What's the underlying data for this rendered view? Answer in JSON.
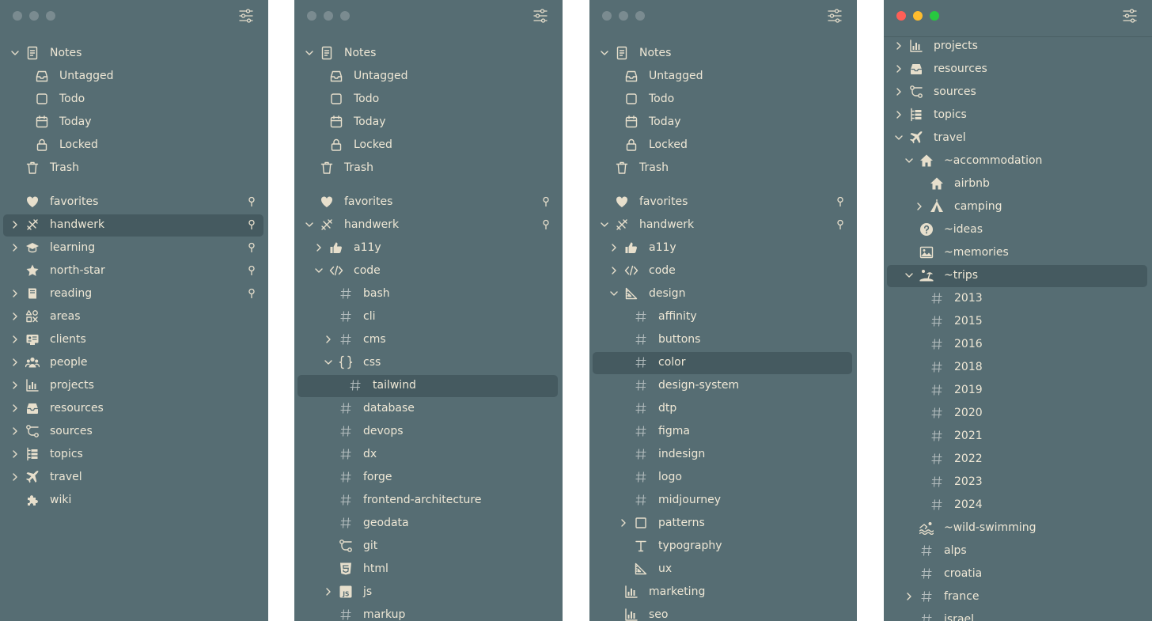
{
  "colors": {
    "panel_bg": "#566d73",
    "selected_bg": "#455a60",
    "text": "#eee7d5",
    "icon": "#e7dfcc",
    "hash": "#b4bdbe"
  },
  "panels": [
    {
      "titlebar_style": "inactive",
      "items": [
        {
          "label": "Notes",
          "icon": "note",
          "expand": "down"
        },
        {
          "label": "Untagged",
          "icon": "tray"
        },
        {
          "label": "Todo",
          "icon": "checkbox"
        },
        {
          "label": "Today",
          "icon": "calendar"
        },
        {
          "label": "Locked",
          "icon": "lock"
        },
        {
          "label": "Trash",
          "icon": "trash"
        },
        {
          "label": "favorites",
          "icon": "heart",
          "pinned": true
        },
        {
          "label": "handwerk",
          "icon": "tools",
          "expand": "right",
          "pinned": true,
          "selected": true
        },
        {
          "label": "learning",
          "icon": "graduation",
          "expand": "right",
          "pinned": true
        },
        {
          "label": "north-star",
          "icon": "star",
          "pinned": true
        },
        {
          "label": "reading",
          "icon": "book",
          "expand": "right",
          "pinned": true
        },
        {
          "label": "areas",
          "icon": "shapes",
          "expand": "right"
        },
        {
          "label": "clients",
          "icon": "id-card",
          "expand": "right"
        },
        {
          "label": "people",
          "icon": "people",
          "expand": "right"
        },
        {
          "label": "projects",
          "icon": "chart",
          "expand": "right"
        },
        {
          "label": "resources",
          "icon": "tray-filled",
          "expand": "right"
        },
        {
          "label": "sources",
          "icon": "branch",
          "expand": "right"
        },
        {
          "label": "topics",
          "icon": "list",
          "expand": "right"
        },
        {
          "label": "travel",
          "icon": "plane",
          "expand": "right"
        },
        {
          "label": "wiki",
          "icon": "puzzle"
        }
      ]
    },
    {
      "titlebar_style": "inactive",
      "items": [
        {
          "label": "Notes",
          "icon": "note",
          "expand": "down"
        },
        {
          "label": "Untagged",
          "icon": "tray"
        },
        {
          "label": "Todo",
          "icon": "checkbox"
        },
        {
          "label": "Today",
          "icon": "calendar"
        },
        {
          "label": "Locked",
          "icon": "lock"
        },
        {
          "label": "Trash",
          "icon": "trash"
        },
        {
          "label": "favorites",
          "icon": "heart",
          "pinned": true
        },
        {
          "label": "handwerk",
          "icon": "tools",
          "expand": "down",
          "pinned": true
        },
        {
          "label": "a11y",
          "icon": "thumb",
          "expand": "right"
        },
        {
          "label": "code",
          "icon": "code",
          "expand": "down"
        },
        {
          "label": "bash",
          "icon": "hash"
        },
        {
          "label": "cli",
          "icon": "hash"
        },
        {
          "label": "cms",
          "icon": "hash",
          "expand": "right"
        },
        {
          "label": "css",
          "icon": "braces",
          "expand": "down"
        },
        {
          "label": "tailwind",
          "icon": "hash",
          "selected": true
        },
        {
          "label": "database",
          "icon": "hash"
        },
        {
          "label": "devops",
          "icon": "hash"
        },
        {
          "label": "dx",
          "icon": "hash"
        },
        {
          "label": "forge",
          "icon": "hash"
        },
        {
          "label": "frontend-architecture",
          "icon": "hash"
        },
        {
          "label": "geodata",
          "icon": "hash"
        },
        {
          "label": "git",
          "icon": "branch"
        },
        {
          "label": "html",
          "icon": "html5"
        },
        {
          "label": "js",
          "icon": "js",
          "expand": "right"
        },
        {
          "label": "markup",
          "icon": "hash"
        }
      ]
    },
    {
      "titlebar_style": "inactive",
      "items": [
        {
          "label": "Notes",
          "icon": "note",
          "expand": "down"
        },
        {
          "label": "Untagged",
          "icon": "tray"
        },
        {
          "label": "Todo",
          "icon": "checkbox"
        },
        {
          "label": "Today",
          "icon": "calendar"
        },
        {
          "label": "Locked",
          "icon": "lock"
        },
        {
          "label": "Trash",
          "icon": "trash"
        },
        {
          "label": "favorites",
          "icon": "heart",
          "pinned": true
        },
        {
          "label": "handwerk",
          "icon": "tools",
          "expand": "down",
          "pinned": true
        },
        {
          "label": "a11y",
          "icon": "thumb",
          "expand": "right"
        },
        {
          "label": "code",
          "icon": "code",
          "expand": "right"
        },
        {
          "label": "design",
          "icon": "triangle-ruler",
          "expand": "down"
        },
        {
          "label": "affinity",
          "icon": "hash"
        },
        {
          "label": "buttons",
          "icon": "hash"
        },
        {
          "label": "color",
          "icon": "hash",
          "selected": true
        },
        {
          "label": "design-system",
          "icon": "hash"
        },
        {
          "label": "dtp",
          "icon": "hash"
        },
        {
          "label": "figma",
          "icon": "hash"
        },
        {
          "label": "indesign",
          "icon": "hash"
        },
        {
          "label": "logo",
          "icon": "hash"
        },
        {
          "label": "midjourney",
          "icon": "hash"
        },
        {
          "label": "patterns",
          "icon": "square",
          "expand": "right"
        },
        {
          "label": "typography",
          "icon": "type"
        },
        {
          "label": "ux",
          "icon": "triangle-ruler"
        },
        {
          "label": "marketing",
          "icon": "chart"
        },
        {
          "label": "seo",
          "icon": "chart"
        }
      ]
    },
    {
      "titlebar_style": "active",
      "items": [
        {
          "label": "projects",
          "icon": "chart",
          "expand": "right"
        },
        {
          "label": "resources",
          "icon": "tray-filled",
          "expand": "right"
        },
        {
          "label": "sources",
          "icon": "branch",
          "expand": "right"
        },
        {
          "label": "topics",
          "icon": "list",
          "expand": "right"
        },
        {
          "label": "travel",
          "icon": "plane",
          "expand": "down"
        },
        {
          "label": "~accommodation",
          "icon": "house",
          "expand": "down"
        },
        {
          "label": "airbnb",
          "icon": "house"
        },
        {
          "label": "camping",
          "icon": "tent",
          "expand": "right"
        },
        {
          "label": "~ideas",
          "icon": "question"
        },
        {
          "label": "~memories",
          "icon": "picture"
        },
        {
          "label": "~trips",
          "icon": "beach",
          "expand": "down",
          "selected": true
        },
        {
          "label": "2013",
          "icon": "hash"
        },
        {
          "label": "2015",
          "icon": "hash"
        },
        {
          "label": "2016",
          "icon": "hash"
        },
        {
          "label": "2018",
          "icon": "hash"
        },
        {
          "label": "2019",
          "icon": "hash"
        },
        {
          "label": "2020",
          "icon": "hash"
        },
        {
          "label": "2021",
          "icon": "hash"
        },
        {
          "label": "2022",
          "icon": "hash"
        },
        {
          "label": "2023",
          "icon": "hash"
        },
        {
          "label": "2024",
          "icon": "hash"
        },
        {
          "label": "~wild-swimming",
          "icon": "swim"
        },
        {
          "label": "alps",
          "icon": "hash"
        },
        {
          "label": "croatia",
          "icon": "hash"
        },
        {
          "label": "france",
          "icon": "hash",
          "expand": "right"
        },
        {
          "label": "israel",
          "icon": "hash"
        }
      ]
    }
  ]
}
